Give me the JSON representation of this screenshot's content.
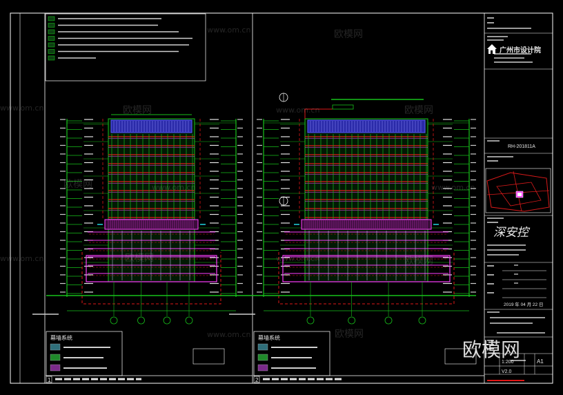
{
  "watermark": {
    "url": "www.om.cn",
    "brand": "欧模网",
    "corner_brand": "欧模网"
  },
  "colors": {
    "background": "#000000",
    "frame": "#ffffff",
    "green": "#17c21a",
    "magenta": "#ff3dff",
    "red": "#e11717",
    "blue": "#5b5bff",
    "cyan": "#21d7e0",
    "yellow": "#ffe000"
  },
  "legend_panels": [
    {
      "title": "幕墙系统",
      "swatches": [
        "#2f6f7a",
        "#1f8a2a",
        "#7a2a8a"
      ]
    },
    {
      "title": "幕墙系统",
      "swatches": [
        "#2f6f7a",
        "#1f8a2a",
        "#7a2a8a"
      ]
    }
  ],
  "drawing_titles": [
    {
      "num": "1"
    },
    {
      "num": "2"
    }
  ],
  "title_block": {
    "logo_text": "广州市设计院",
    "project_no": "RH-201811A",
    "stamp_text": "深安控",
    "date": "2019 年 04 月 22 日",
    "scale": "1:200",
    "sheet_size": "A1",
    "version": "V2.0"
  },
  "icons": [
    "house-logo-icon",
    "north-arrow-icon",
    "key-plan-icon"
  ]
}
